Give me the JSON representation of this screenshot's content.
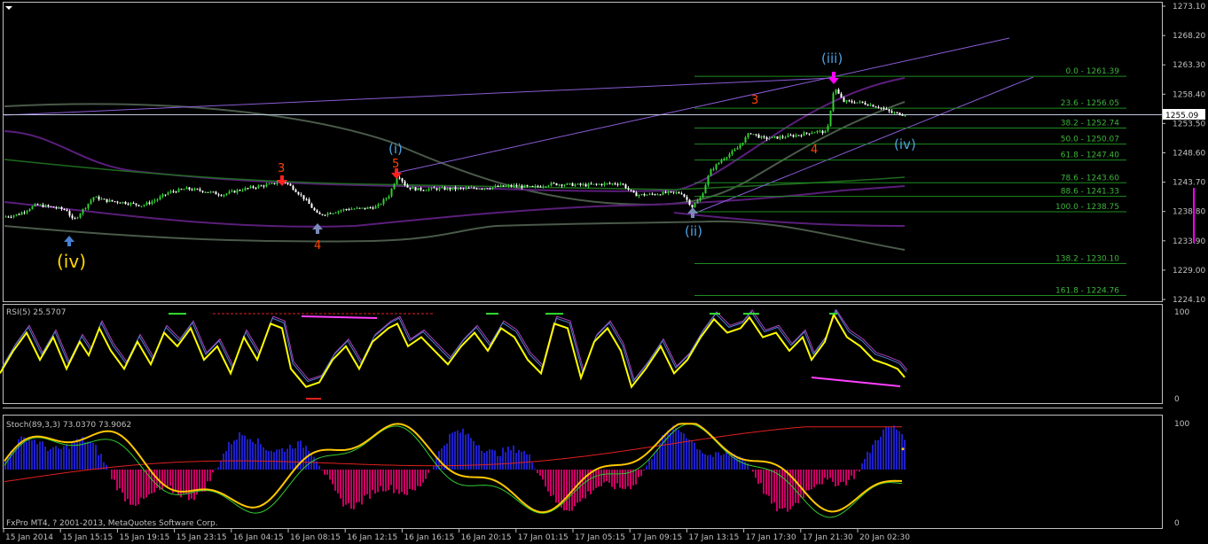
{
  "app": {
    "copyright": "FxPro MT4, ? 2001-2013, MetaQuotes Software Corp.",
    "colors": {
      "background": "#000000",
      "frame": "#c0c0c0",
      "candle_up": "#32cd32",
      "candle_down": "#ffffff",
      "fib": "#1e8c1e",
      "channel": "#8a5cd6",
      "ma": "#4a5a4a",
      "band": "#5a1e7a",
      "rsi": "#ffff00",
      "histo_pos": "#1e1ec8",
      "histo_neg": "#c80064"
    }
  },
  "price_axis": {
    "ticks": [
      "1273.10",
      "1268.20",
      "1263.30",
      "1258.40",
      "1253.50",
      "1248.60",
      "1243.70",
      "1238.80",
      "1233.90",
      "1229.00",
      "1224.10"
    ],
    "current": "1255.09"
  },
  "time_axis": {
    "labels": [
      "15 Jan 2014",
      "15 Jan 15:15",
      "15 Jan 19:15",
      "15 Jan 23:15",
      "16 Jan 04:15",
      "16 Jan 08:15",
      "16 Jan 12:15",
      "16 Jan 16:15",
      "16 Jan 20:15",
      "17 Jan 01:15",
      "17 Jan 05:15",
      "17 Jan 09:15",
      "17 Jan 13:15",
      "17 Jan 17:30",
      "17 Jan 21:30",
      "20 Jan 02:30"
    ]
  },
  "fibonacci": [
    {
      "label": "0.0 - 1261.39"
    },
    {
      "label": "23.6 - 1256.05"
    },
    {
      "label": "38.2 - 1252.74"
    },
    {
      "label": "50.0 - 1250.07"
    },
    {
      "label": "61.8 - 1247.40"
    },
    {
      "label": "78.6 - 1243.60"
    },
    {
      "label": "88.6 - 1241.33"
    },
    {
      "label": "100.0 - 1238.75"
    },
    {
      "label": "138.2 - 1230.10"
    },
    {
      "label": "161.8 - 1224.76"
    }
  ],
  "wave_labels": {
    "iv_main": "(iv)",
    "i": "(i)",
    "ii": "(ii)",
    "iii": "(iii)",
    "iv_small": "(iv)",
    "w3a": "3",
    "w4a": "4",
    "w5": "5",
    "w3b": "3",
    "w4b": "4"
  },
  "rsi": {
    "title": "RSI(5) 25.5707",
    "levels": [
      "100",
      "0"
    ]
  },
  "stoch": {
    "title": "Stoch(89,3,3) 73.0370 73.9062",
    "levels": [
      "100",
      "0"
    ]
  },
  "chart_data": [
    {
      "type": "candlestick",
      "title": "",
      "ylim": [
        1224.1,
        1273.1
      ],
      "y_ticks": [
        1273.1,
        1268.2,
        1263.3,
        1258.4,
        1253.5,
        1248.6,
        1243.7,
        1238.8,
        1233.9,
        1229.0,
        1224.1
      ],
      "current_price": 1255.09,
      "close_path": [
        [
          0,
          1237.8
        ],
        [
          20,
          1238.3
        ],
        [
          40,
          1239.9
        ],
        [
          60,
          1239.5
        ],
        [
          75,
          1239.0
        ],
        [
          82,
          1237.2
        ],
        [
          92,
          1238.9
        ],
        [
          105,
          1241.2
        ],
        [
          120,
          1240.6
        ],
        [
          140,
          1240.3
        ],
        [
          160,
          1239.8
        ],
        [
          175,
          1240.7
        ],
        [
          190,
          1242.0
        ],
        [
          210,
          1242.6
        ],
        [
          230,
          1242.2
        ],
        [
          250,
          1241.6
        ],
        [
          270,
          1242.4
        ],
        [
          290,
          1243.0
        ],
        [
          305,
          1243.3
        ],
        [
          318,
          1244.0
        ],
        [
          330,
          1242.7
        ],
        [
          345,
          1240.6
        ],
        [
          358,
          1238.2
        ],
        [
          372,
          1238.6
        ],
        [
          390,
          1239.2
        ],
        [
          410,
          1239.3
        ],
        [
          425,
          1239.6
        ],
        [
          438,
          1241.5
        ],
        [
          448,
          1245.0
        ],
        [
          458,
          1242.9
        ],
        [
          470,
          1242.5
        ],
        [
          490,
          1242.6
        ],
        [
          520,
          1242.6
        ],
        [
          550,
          1242.8
        ],
        [
          580,
          1243.1
        ],
        [
          600,
          1242.8
        ],
        [
          620,
          1243.4
        ],
        [
          640,
          1243.3
        ],
        [
          660,
          1243.2
        ],
        [
          680,
          1243.4
        ],
        [
          700,
          1243.5
        ],
        [
          715,
          1241.6
        ],
        [
          730,
          1241.6
        ],
        [
          750,
          1241.9
        ],
        [
          768,
          1241.9
        ],
        [
          780,
          1239.6
        ],
        [
          790,
          1241.2
        ],
        [
          800,
          1245.5
        ],
        [
          815,
          1247.7
        ],
        [
          830,
          1249.2
        ],
        [
          845,
          1252.0
        ],
        [
          860,
          1251.0
        ],
        [
          880,
          1251.2
        ],
        [
          900,
          1251.6
        ],
        [
          920,
          1252.2
        ],
        [
          932,
          1252.0
        ],
        [
          940,
          1259.6
        ],
        [
          950,
          1257.2
        ],
        [
          970,
          1257.0
        ],
        [
          990,
          1256.3
        ],
        [
          1005,
          1255.3
        ],
        [
          1015,
          1255.1
        ],
        [
          1022,
          1255.09
        ]
      ]
    },
    {
      "type": "line",
      "title": "RSI(5) 25.5707",
      "ylim": [
        0,
        100
      ],
      "series": [
        {
          "name": "RSI(5)",
          "values": [
            [
              0,
              30
            ],
            [
              15,
              55
            ],
            [
              30,
              75
            ],
            [
              45,
              45
            ],
            [
              60,
              70
            ],
            [
              75,
              35
            ],
            [
              90,
              65
            ],
            [
              100,
              50
            ],
            [
              112,
              80
            ],
            [
              125,
              55
            ],
            [
              140,
              35
            ],
            [
              155,
              65
            ],
            [
              170,
              40
            ],
            [
              185,
              75
            ],
            [
              200,
              60
            ],
            [
              215,
              80
            ],
            [
              230,
              45
            ],
            [
              245,
              60
            ],
            [
              260,
              30
            ],
            [
              275,
              70
            ],
            [
              290,
              45
            ],
            [
              305,
              85
            ],
            [
              318,
              80
            ],
            [
              328,
              35
            ],
            [
              345,
              15
            ],
            [
              360,
              20
            ],
            [
              375,
              45
            ],
            [
              390,
              60
            ],
            [
              405,
              35
            ],
            [
              420,
              65
            ],
            [
              438,
              80
            ],
            [
              448,
              85
            ],
            [
              460,
              60
            ],
            [
              475,
              70
            ],
            [
              490,
              55
            ],
            [
              505,
              40
            ],
            [
              520,
              60
            ],
            [
              535,
              75
            ],
            [
              550,
              55
            ],
            [
              565,
              80
            ],
            [
              580,
              70
            ],
            [
              595,
              45
            ],
            [
              610,
              30
            ],
            [
              625,
              85
            ],
            [
              640,
              80
            ],
            [
              655,
              25
            ],
            [
              670,
              65
            ],
            [
              685,
              80
            ],
            [
              700,
              55
            ],
            [
              712,
              15
            ],
            [
              728,
              35
            ],
            [
              745,
              60
            ],
            [
              760,
              30
            ],
            [
              775,
              45
            ],
            [
              790,
              70
            ],
            [
              805,
              90
            ],
            [
              820,
              75
            ],
            [
              835,
              80
            ],
            [
              845,
              92
            ],
            [
              860,
              70
            ],
            [
              875,
              75
            ],
            [
              890,
              55
            ],
            [
              905,
              70
            ],
            [
              915,
              45
            ],
            [
              930,
              65
            ],
            [
              940,
              95
            ],
            [
              955,
              70
            ],
            [
              970,
              60
            ],
            [
              985,
              45
            ],
            [
              1000,
              40
            ],
            [
              1012,
              35
            ],
            [
              1020,
              25.5707
            ]
          ]
        }
      ]
    },
    {
      "type": "bar",
      "title": "Stoch(89,3,3) 73.0370 73.9062",
      "ylim": [
        0,
        100
      ],
      "series": [
        {
          "name": "Stoch(89,3,3)",
          "values": [
            73.037,
            73.9062
          ]
        }
      ]
    }
  ]
}
